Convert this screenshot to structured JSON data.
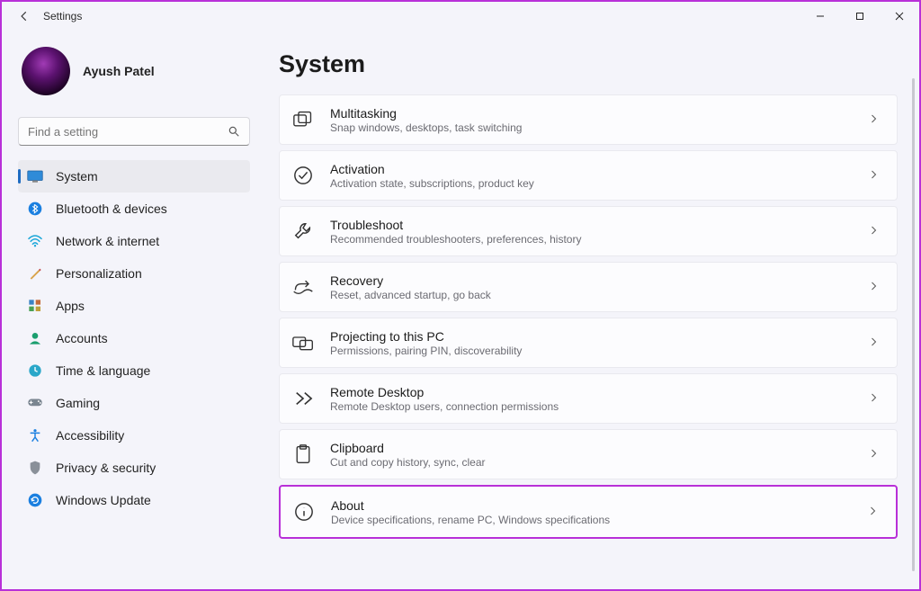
{
  "window": {
    "title": "Settings"
  },
  "profile": {
    "name": "Ayush Patel"
  },
  "search": {
    "placeholder": "Find a setting"
  },
  "nav": {
    "items": [
      {
        "key": "system",
        "label": "System",
        "active": true
      },
      {
        "key": "bluetooth",
        "label": "Bluetooth & devices",
        "active": false
      },
      {
        "key": "network",
        "label": "Network & internet",
        "active": false
      },
      {
        "key": "personalization",
        "label": "Personalization",
        "active": false
      },
      {
        "key": "apps",
        "label": "Apps",
        "active": false
      },
      {
        "key": "accounts",
        "label": "Accounts",
        "active": false
      },
      {
        "key": "time",
        "label": "Time & language",
        "active": false
      },
      {
        "key": "gaming",
        "label": "Gaming",
        "active": false
      },
      {
        "key": "accessibility",
        "label": "Accessibility",
        "active": false
      },
      {
        "key": "privacy",
        "label": "Privacy & security",
        "active": false
      },
      {
        "key": "update",
        "label": "Windows Update",
        "active": false
      }
    ]
  },
  "page": {
    "heading": "System",
    "cards": [
      {
        "key": "multitasking",
        "title": "Multitasking",
        "sub": "Snap windows, desktops, task switching"
      },
      {
        "key": "activation",
        "title": "Activation",
        "sub": "Activation state, subscriptions, product key"
      },
      {
        "key": "troubleshoot",
        "title": "Troubleshoot",
        "sub": "Recommended troubleshooters, preferences, history"
      },
      {
        "key": "recovery",
        "title": "Recovery",
        "sub": "Reset, advanced startup, go back"
      },
      {
        "key": "projecting",
        "title": "Projecting to this PC",
        "sub": "Permissions, pairing PIN, discoverability"
      },
      {
        "key": "remote",
        "title": "Remote Desktop",
        "sub": "Remote Desktop users, connection permissions"
      },
      {
        "key": "clipboard",
        "title": "Clipboard",
        "sub": "Cut and copy history, sync, clear"
      },
      {
        "key": "about",
        "title": "About",
        "sub": "Device specifications, rename PC, Windows specifications",
        "highlight": true
      }
    ]
  }
}
